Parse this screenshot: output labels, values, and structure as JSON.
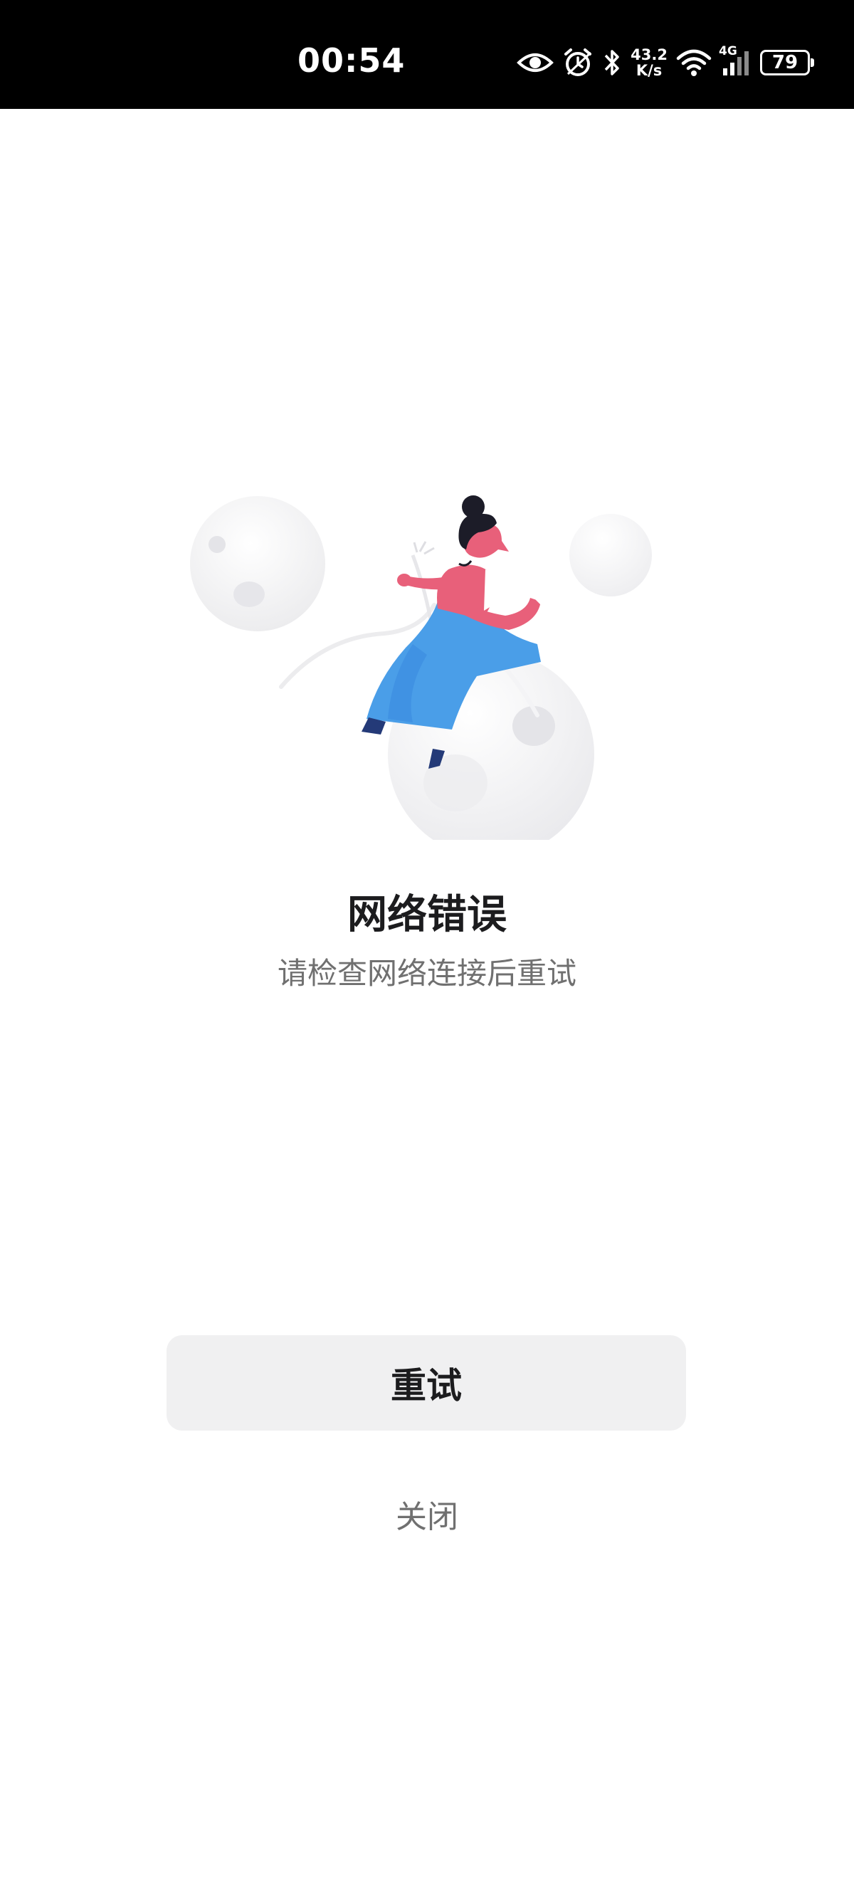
{
  "status_bar": {
    "time": "00:54",
    "net_speed_value": "43.2",
    "net_speed_unit": "K/s",
    "network_type": "4G",
    "battery": "79",
    "icons": [
      "eye-icon",
      "alarm-icon",
      "bluetooth-icon",
      "wifi-icon",
      "signal-icon",
      "battery-icon"
    ]
  },
  "error": {
    "title": "网络错误",
    "subtitle": "请检查网络连接后重试"
  },
  "actions": {
    "retry_label": "重试",
    "close_label": "关闭"
  },
  "colors": {
    "accent_pink": "#e8607a",
    "accent_blue": "#4a9ee8",
    "button_bg": "#f0f0f1"
  }
}
